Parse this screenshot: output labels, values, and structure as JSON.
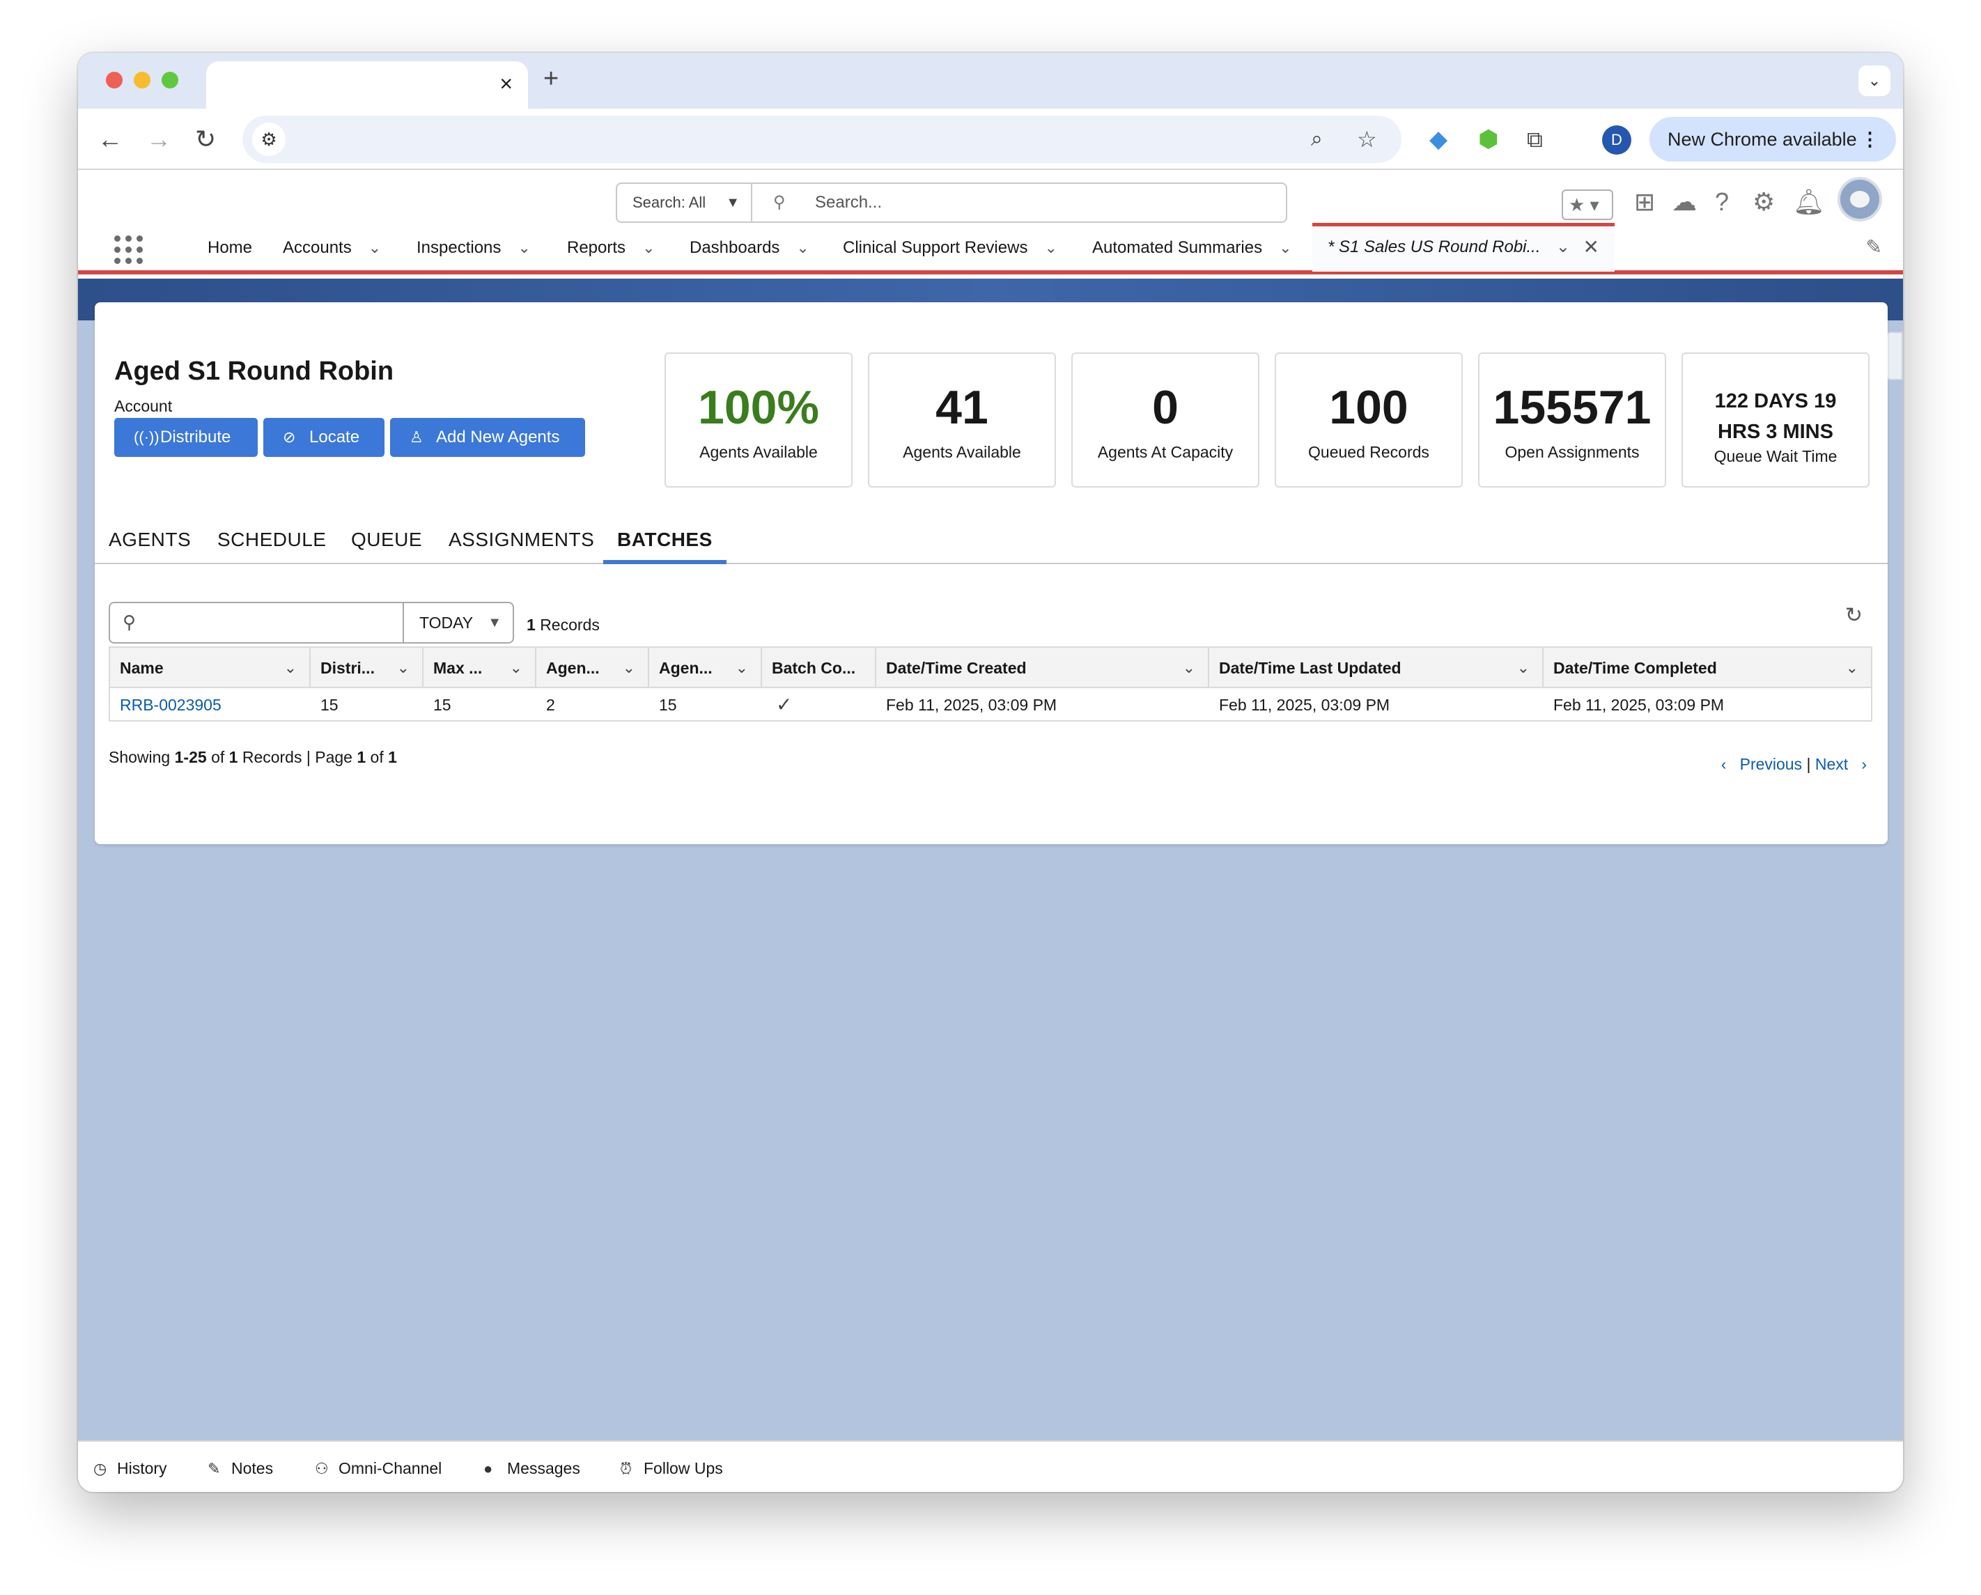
{
  "browser": {
    "tab_close": "×",
    "new_tab": "+",
    "tab_menu": "⌄",
    "new_chrome_label": "New Chrome available",
    "profile_initial": "D"
  },
  "header": {
    "search_scope": "Search: All",
    "search_placeholder": "Search..."
  },
  "nav": {
    "items": [
      "Home",
      "Accounts",
      "Inspections",
      "Reports",
      "Dashboards",
      "Clinical Support Reviews",
      "Automated Summaries"
    ],
    "active_tab": "* S1 Sales US Round Robi..."
  },
  "record": {
    "title": "Aged S1 Round Robin",
    "subtitle": "Account",
    "buttons": [
      "Distribute",
      "Locate",
      "Add New Agents"
    ]
  },
  "stats": [
    {
      "value": "100%",
      "label": "Agents Available",
      "color": "#3a7d1e"
    },
    {
      "value": "41",
      "label": "Agents Available"
    },
    {
      "value": "0",
      "label": "Agents At Capacity"
    },
    {
      "value": "100",
      "label": "Queued Records"
    },
    {
      "value": "155571",
      "label": "Open Assignments"
    },
    {
      "value_line1": "122 DAYS 19",
      "value_line2": "HRS 3 MINS",
      "label": "Queue Wait Time"
    }
  ],
  "tabs": [
    "AGENTS",
    "SCHEDULE",
    "QUEUE",
    "ASSIGNMENTS",
    "BATCHES"
  ],
  "active_tab_index": 4,
  "filter": {
    "search_value": "",
    "period": "TODAY",
    "record_count_num": "1",
    "record_count_label": "Records"
  },
  "table": {
    "columns": [
      "Name",
      "Distri...",
      "Max ...",
      "Agen...",
      "Agen...",
      "Batch Co...",
      "Date/Time Created",
      "Date/Time Last Updated",
      "Date/Time Completed"
    ],
    "rows": [
      {
        "name": "RRB-0023905",
        "distri": "15",
        "max": "15",
        "agen1": "2",
        "agen2": "15",
        "batch_complete": true,
        "created": "Feb 11, 2025, 03:09 PM",
        "updated": "Feb 11, 2025, 03:09 PM",
        "completed": "Feb 11, 2025, 03:09 PM"
      }
    ]
  },
  "pager": {
    "showing": "Showing",
    "range": "1-25",
    "of": "of",
    "total": "1",
    "records_page": "Records | Page",
    "page": "1",
    "of2": "of",
    "pages": "1",
    "previous": "Previous",
    "separator": "|",
    "next": "Next"
  },
  "utility_bar": [
    "History",
    "Notes",
    "Omni-Channel",
    "Messages",
    "Follow Ups"
  ]
}
